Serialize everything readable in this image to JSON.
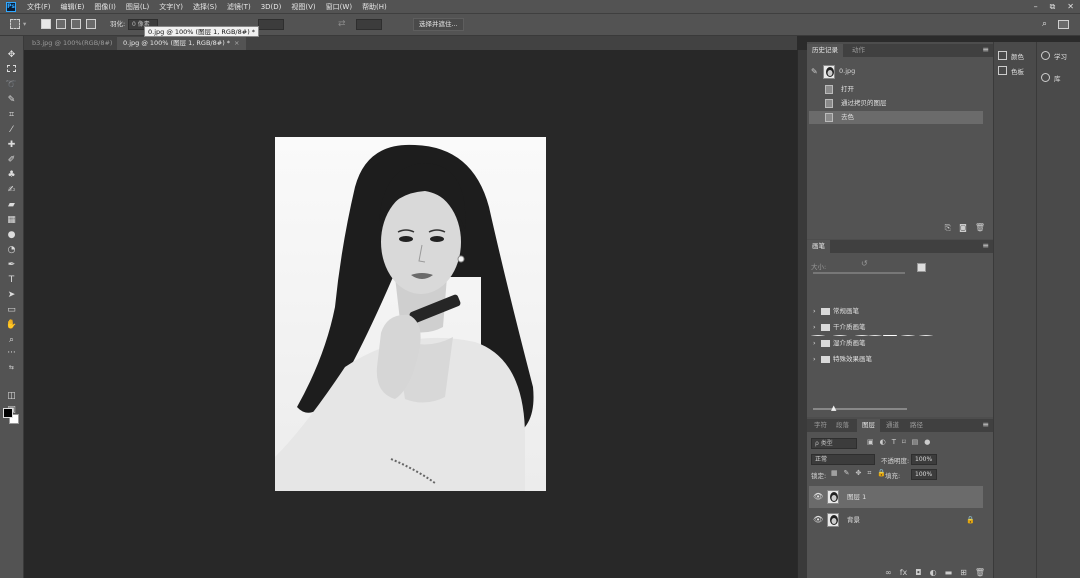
{
  "menubar": {
    "logo": "Ps",
    "items": [
      "文件(F)",
      "编辑(E)",
      "图像(I)",
      "图层(L)",
      "文字(Y)",
      "选择(S)",
      "滤镜(T)",
      "3D(D)",
      "视图(V)",
      "窗口(W)",
      "帮助(H)"
    ],
    "window_controls": [
      "–",
      "⧉",
      "✕"
    ]
  },
  "options": {
    "feather_label": "羽化:",
    "feather_value": "0 像素",
    "select_mask_button": "选择并遮住..."
  },
  "tooltip": "0.jpg @ 100% (图层 1, RGB/8#) *",
  "doc_tabs": [
    {
      "label": "b3.jpg @ 100%(RGB/8#)",
      "close": "×"
    },
    {
      "label": "0.jpg @ 100% (图层 1, RGB/8#) *",
      "close": "×"
    }
  ],
  "history_panel": {
    "tabs": [
      "历史记录",
      "动作"
    ],
    "snapshot_label": "0.jpg",
    "steps": [
      "打开",
      "通过拷贝的图层",
      "去色"
    ],
    "selected_step": 2
  },
  "brush_panel": {
    "tab": "画笔",
    "size_label": "大小:",
    "folders": [
      "常规画笔",
      "干介质画笔",
      "湿介质画笔",
      "特殊效果画笔"
    ]
  },
  "layers_panel": {
    "tabs": [
      "字符",
      "段落",
      "图层",
      "通道",
      "路径"
    ],
    "active_tab": 2,
    "filter_kind": "ρ 类型",
    "blend_mode": "正常",
    "opacity_label": "不透明度:",
    "opacity_value": "100%",
    "lock_label": "锁定:",
    "fill_label": "填充:",
    "fill_value": "100%",
    "layers": [
      {
        "name": "图层 1",
        "selected": true,
        "locked": false
      },
      {
        "name": "背景",
        "selected": false,
        "locked": true
      }
    ]
  },
  "side_panels": {
    "mid": [
      "颜色",
      "色板"
    ],
    "right": [
      "学习",
      "库"
    ]
  },
  "colors": {
    "ui_bg": "#535353",
    "canvas_bg": "#282828",
    "accent": "#31a8ff"
  }
}
